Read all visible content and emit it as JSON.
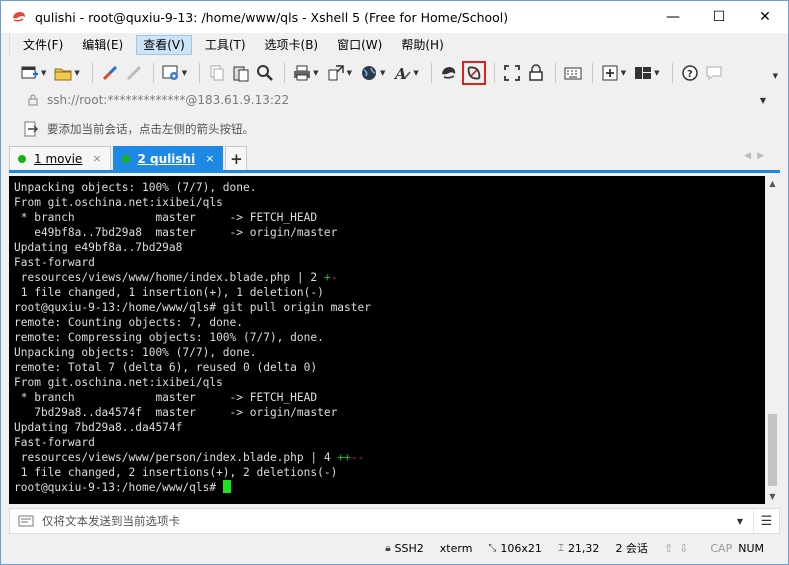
{
  "window": {
    "title": "qulishi - root@quxiu-9-13: /home/www/qls - Xshell 5 (Free for Home/School)",
    "minimize": "—",
    "maximize": "☐",
    "close": "✕"
  },
  "menu": [
    "文件(F)",
    "编辑(E)",
    "查看(V)",
    "工具(T)",
    "选项卡(B)",
    "窗口(W)",
    "帮助(H)"
  ],
  "address": {
    "text": "ssh://root:*************@183.61.9.13:22"
  },
  "hint": {
    "text": "要添加当前会话，点击左侧的箭头按钮。"
  },
  "tabs": [
    {
      "label": "1 movie",
      "close": "×"
    },
    {
      "label": "2 qulishi",
      "close": "×"
    }
  ],
  "tab_add": "+",
  "terminal_lines": [
    "Unpacking objects: 100% (7/7), done.",
    "From git.oschina.net:ixibei/qls",
    " * branch            master     -> FETCH_HEAD",
    "   e49bf8a..7bd29a8  master     -> origin/master",
    "Updating e49bf8a..7bd29a8",
    "Fast-forward",
    " resources/views/www/home/index.blade.php | 2 ",
    " 1 file changed, 1 insertion(+), 1 deletion(-)",
    "root@quxiu-9-13:/home/www/qls# git pull origin master",
    "remote: Counting objects: 7, done.",
    "remote: Compressing objects: 100% (7/7), done.",
    "Unpacking objects: 100% (7/7), done.",
    "remote: Total 7 (delta 6), reused 0 (delta 0)",
    "From git.oschina.net:ixibei/qls",
    " * branch            master     -> FETCH_HEAD",
    "   7bd29a8..da4574f  master     -> origin/master",
    "Updating 7bd29a8..da4574f",
    "Fast-forward",
    " resources/views/www/person/index.blade.php | 4 ",
    " 1 file changed, 2 insertions(+), 2 deletions(-)",
    "root@quxiu-9-13:/home/www/qls# "
  ],
  "diffstat": {
    "line7_plus": "+",
    "line7_minus": "-",
    "line19_plus": "++",
    "line19_minus": "--"
  },
  "compose": {
    "text": "仅将文本发送到当前选项卡"
  },
  "status": {
    "protocol": "SSH2",
    "term": "xterm",
    "size": "106x21",
    "cursor_pos": "21,32",
    "sessions": "2 会话",
    "cap": "CAP",
    "num": "NUM"
  },
  "colors": {
    "accent": "#1e88e5",
    "terminal_bg": "#000000",
    "terminal_fg": "#dcdcdc",
    "cursor": "#19e619",
    "highlight_border": "#e02020"
  }
}
